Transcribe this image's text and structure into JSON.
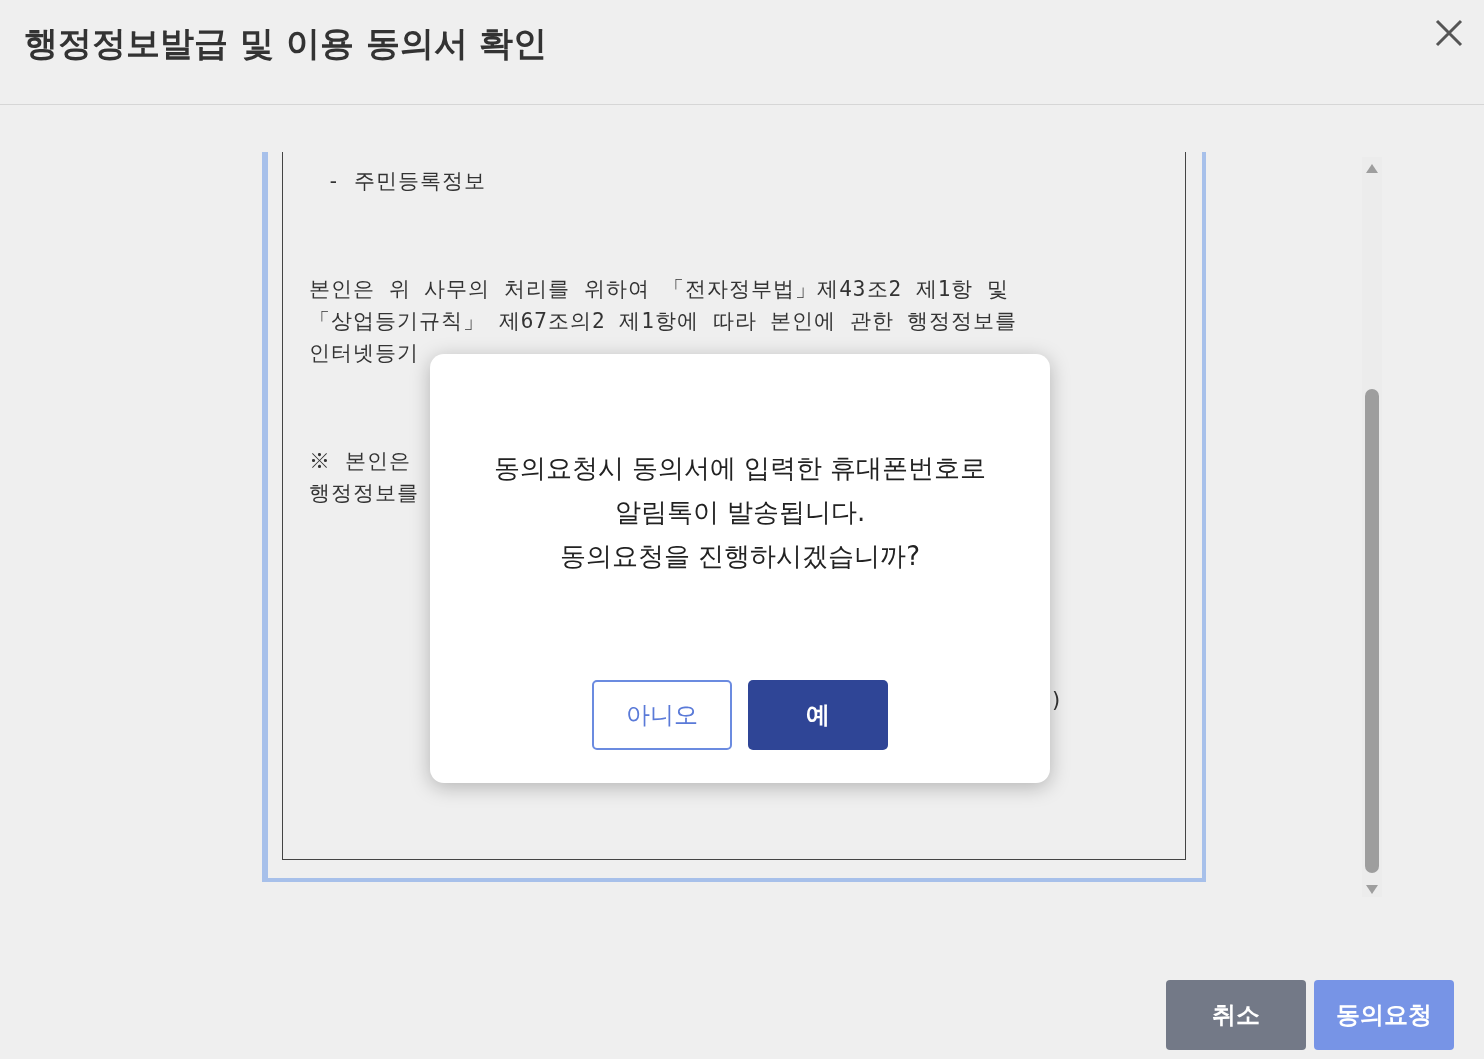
{
  "window": {
    "title": "행정정보발급 및 이용 동의서 확인"
  },
  "document": {
    "lines": [
      {
        "kind": "item",
        "text": "- 주민등록정보"
      },
      {
        "kind": "gap"
      },
      {
        "kind": "para",
        "text": " 본인은 위 사무의 처리를 위하여 「전자정부법」제43조2 제1항 및"
      },
      {
        "kind": "para",
        "text": "「상업등기규칙」 제67조의2 제1항에 따라 본인에 관한 행정정보를"
      },
      {
        "kind": "para",
        "text": "인터넷등기"
      },
      {
        "kind": "gap"
      },
      {
        "kind": "para",
        "text": "※ 본인은"
      },
      {
        "kind": "para",
        "text": "행정정보를"
      }
    ],
    "fragment": ")"
  },
  "dialog": {
    "message": [
      "동의요청시 동의서에 입력한 휴대폰번호로",
      "알림톡이 발송됩니다.",
      "동의요청을 진행하시겠습니까?"
    ],
    "buttons": [
      {
        "label": "아니오",
        "kind": "outline"
      },
      {
        "label": "예",
        "kind": "primary"
      }
    ]
  },
  "footer": {
    "buttons": [
      {
        "label": "취소",
        "kind": "secondary"
      },
      {
        "label": "동의요청",
        "kind": "light"
      }
    ]
  }
}
